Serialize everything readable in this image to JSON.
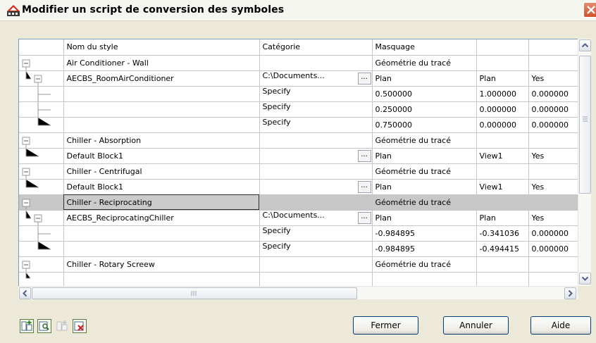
{
  "window": {
    "title": "Modifier un script de conversion des symboles"
  },
  "grid": {
    "columns": [
      "Nom du style",
      "Catégorie",
      "Masquage",
      "",
      ""
    ],
    "rows": [
      {
        "name": "Air Conditioner - Wall",
        "cat": "",
        "mask": "Géométrie du tracé",
        "c4": "",
        "c5": ""
      },
      {
        "name": "AECBS_RoomAirConditioner",
        "cat": "C:\\Documents...",
        "mask": "Plan",
        "c4": "Plan",
        "c5": "Yes"
      },
      {
        "name": "",
        "cat": "Specify",
        "mask": "0.500000",
        "c4": "1.000000",
        "c5": "0.000000"
      },
      {
        "name": "",
        "cat": "Specify",
        "mask": "0.250000",
        "c4": "0.000000",
        "c5": "0.000000"
      },
      {
        "name": "",
        "cat": "Specify",
        "mask": "0.750000",
        "c4": "0.000000",
        "c5": "0.000000"
      },
      {
        "name": "Chiller - Absorption",
        "cat": "",
        "mask": "Géométrie du tracé",
        "c4": "",
        "c5": ""
      },
      {
        "name": "Default Block1",
        "cat": "",
        "mask": "Plan",
        "c4": "View1",
        "c5": "Yes"
      },
      {
        "name": "Chiller - Centrifugal",
        "cat": "",
        "mask": "Géométrie du tracé",
        "c4": "",
        "c5": ""
      },
      {
        "name": "Default Block1",
        "cat": "",
        "mask": "Plan",
        "c4": "View1",
        "c5": "Yes"
      },
      {
        "name": "Chiller - Reciprocating",
        "cat": "",
        "mask": "Géométrie du tracé",
        "c4": "",
        "c5": ""
      },
      {
        "name": "AECBS_ReciprocatingChiller",
        "cat": "C:\\Documents...",
        "mask": "Plan",
        "c4": "Plan",
        "c5": "Yes"
      },
      {
        "name": "",
        "cat": "Specify",
        "mask": "-0.984895",
        "c4": "-0.341036",
        "c5": "0.000000"
      },
      {
        "name": "",
        "cat": "Specify",
        "mask": "-0.984895",
        "c4": "-0.494415",
        "c5": "0.000000"
      },
      {
        "name": "Chiller - Rotary Screew",
        "cat": "",
        "mask": "Géométrie du tracé",
        "c4": "",
        "c5": ""
      },
      {
        "name": "",
        "cat": "",
        "mask": "",
        "c4": "",
        "c5": ""
      }
    ],
    "ellipsis_label": "..."
  },
  "toolbar": {
    "icons": [
      "add-script-icon",
      "browse-block-icon",
      "add-disabled-icon",
      "delete-icon"
    ]
  },
  "buttons": {
    "close": "Fermer",
    "cancel": "Annuler",
    "help": "Aide"
  },
  "colors": {
    "selected_row": "#c7c7c7",
    "border": "#7f9db9",
    "dialog_bg": "#ece9d8"
  }
}
